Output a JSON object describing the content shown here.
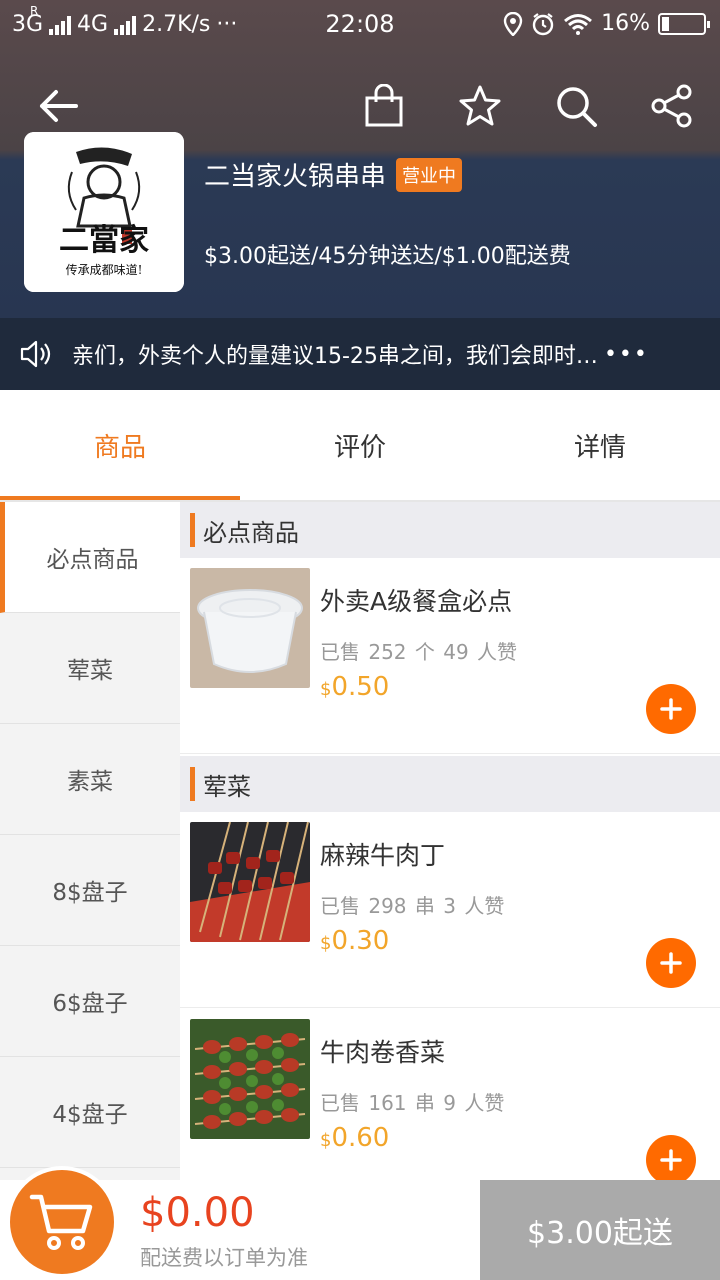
{
  "status_bar": {
    "network1": "3G",
    "network1_sup": "R",
    "network2": "4G",
    "speed": "2.7K/s",
    "dots": "···",
    "time": "22:08",
    "battery": "16%"
  },
  "shop": {
    "name": "二当家火锅串串",
    "status_badge": "营业中",
    "meta": "$3.00起送/45分钟送达/$1.00配送费",
    "logo_text": "二當家",
    "logo_slogan": "传承成都味道!"
  },
  "notice": {
    "text": "亲们，外卖个人的量建议15-25串之间，我们会即时…",
    "more": "•••"
  },
  "tabs": [
    {
      "label": "商品"
    },
    {
      "label": "评价"
    },
    {
      "label": "详情"
    }
  ],
  "sidebar": {
    "items": [
      {
        "label": "必点商品"
      },
      {
        "label": "荤菜"
      },
      {
        "label": "素菜"
      },
      {
        "label": "8$盘子"
      },
      {
        "label": "6$盘子"
      },
      {
        "label": "4$盘子"
      }
    ]
  },
  "sections": [
    {
      "title": "必点商品",
      "products": [
        {
          "name": "外卖A级餐盒必点",
          "sold": "已售 252 个   49 人赞",
          "currency": "$",
          "price": "0.50"
        }
      ]
    },
    {
      "title": "荤菜",
      "products": [
        {
          "name": "麻辣牛肉丁",
          "sold": "已售 298 串   3 人赞",
          "currency": "$",
          "price": "0.30"
        },
        {
          "name": "牛肉卷香菜",
          "sold": "已售 161 串   9 人赞",
          "currency": "$",
          "price": "0.60"
        }
      ]
    }
  ],
  "bottom": {
    "total": "$0.00",
    "fee_note": "配送费以订单为准",
    "checkout": "$3.00起送"
  },
  "colors": {
    "accent": "#ef7a20",
    "price": "#f2a52a",
    "total": "#e8431f",
    "add_button": "#ff6a00"
  }
}
